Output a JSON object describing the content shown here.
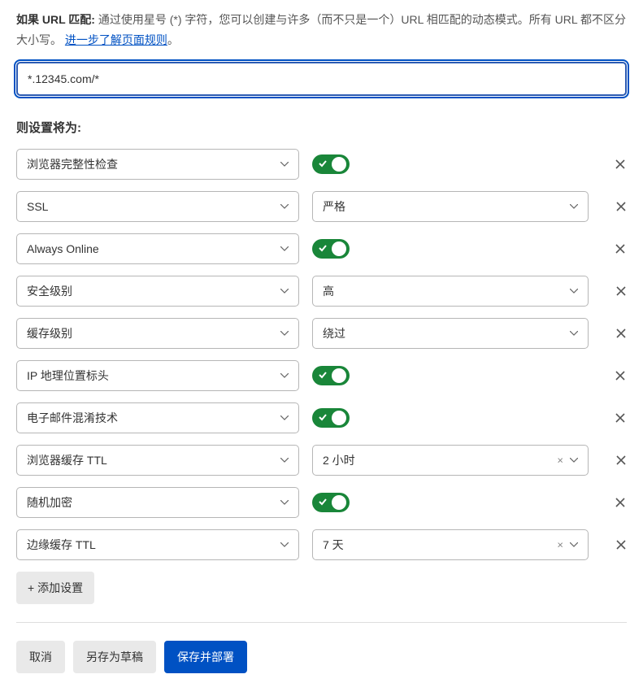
{
  "url_match": {
    "heading": "如果 URL 匹配:",
    "description_part1": "通过使用星号 (*) 字符，您可以创建与许多（而不只是一个）URL 相匹配的动态模式。所有 URL 都不区分大小写。",
    "learn_more": "进一步了解页面规则",
    "period": "。",
    "value": "*.12345.com/*"
  },
  "settings_heading": "则设置将为:",
  "rows": [
    {
      "setting": "浏览器完整性检查",
      "type": "toggle",
      "on": true
    },
    {
      "setting": "SSL",
      "type": "select",
      "value": "严格"
    },
    {
      "setting": "Always Online",
      "type": "toggle",
      "on": true
    },
    {
      "setting": "安全级别",
      "type": "select",
      "value": "高"
    },
    {
      "setting": "缓存级别",
      "type": "select",
      "value": "绕过"
    },
    {
      "setting": "IP 地理位置标头",
      "type": "toggle",
      "on": true
    },
    {
      "setting": "电子邮件混淆技术",
      "type": "toggle",
      "on": true
    },
    {
      "setting": "浏览器缓存 TTL",
      "type": "select_clearable",
      "value": "2 小时"
    },
    {
      "setting": "随机加密",
      "type": "toggle",
      "on": true
    },
    {
      "setting": "边缘缓存 TTL",
      "type": "select_clearable",
      "value": "7 天"
    }
  ],
  "add_setting": "+ 添加设置",
  "footer": {
    "cancel": "取消",
    "save_draft": "另存为草稿",
    "save_deploy": "保存并部署"
  }
}
